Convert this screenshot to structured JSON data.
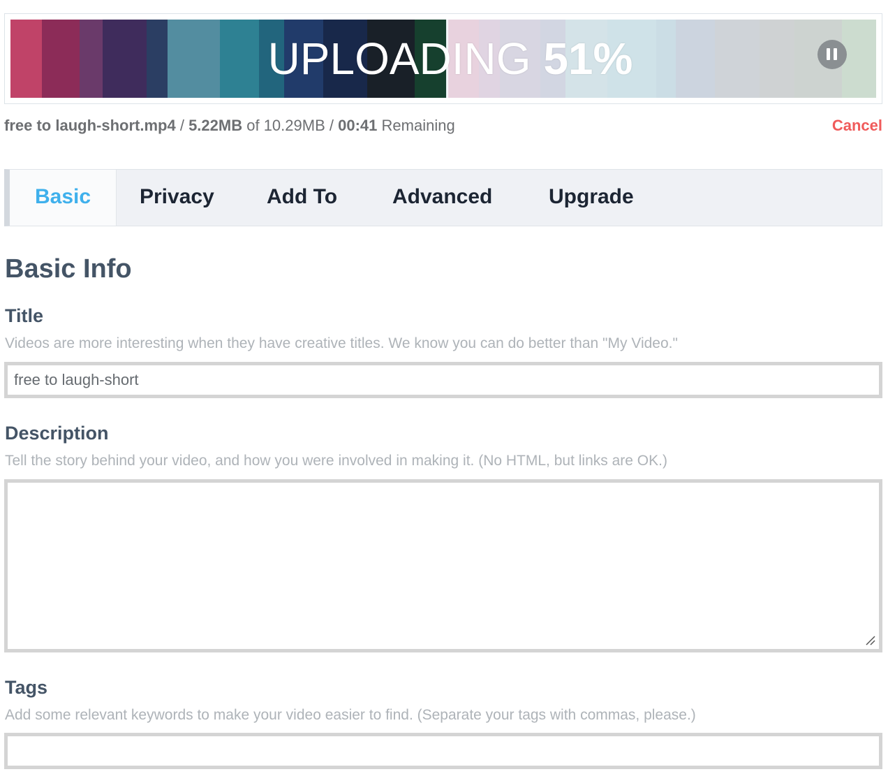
{
  "upload": {
    "status_word": "UPLOADING",
    "percent_text": "51%",
    "progress": 0.51,
    "pause_icon": "pause-icon",
    "filename": "free to laugh-short.mp4",
    "separator": "/",
    "uploaded": "5.22MB",
    "of_text": "of 10.29MB",
    "time_remaining": "00:41",
    "remaining_label": "Remaining",
    "cancel_label": "Cancel",
    "colors": [
      "#c04368",
      "#8c2c58",
      "#6a3a6a",
      "#3f2c5c",
      "#2b3e63",
      "#538da0",
      "#2e8193",
      "#22657d",
      "#213b6a",
      "#18284a",
      "#192028",
      "#16402e"
    ]
  },
  "tabs": [
    {
      "label": "Basic",
      "active": true
    },
    {
      "label": "Privacy",
      "active": false
    },
    {
      "label": "Add To",
      "active": false
    },
    {
      "label": "Advanced",
      "active": false
    },
    {
      "label": "Upgrade",
      "active": false
    }
  ],
  "form": {
    "section_title": "Basic Info",
    "title": {
      "label": "Title",
      "help": "Videos are more interesting when they have creative titles. We know you can do better than \"My Video.\"",
      "value": "free to laugh-short"
    },
    "description": {
      "label": "Description",
      "help": "Tell the story behind your video, and how you were involved in making it. (No HTML, but links are OK.)",
      "value": ""
    },
    "tags": {
      "label": "Tags",
      "help": "Add some relevant keywords to make your video easier to find. (Separate your tags with commas, please.)",
      "value": ""
    }
  }
}
